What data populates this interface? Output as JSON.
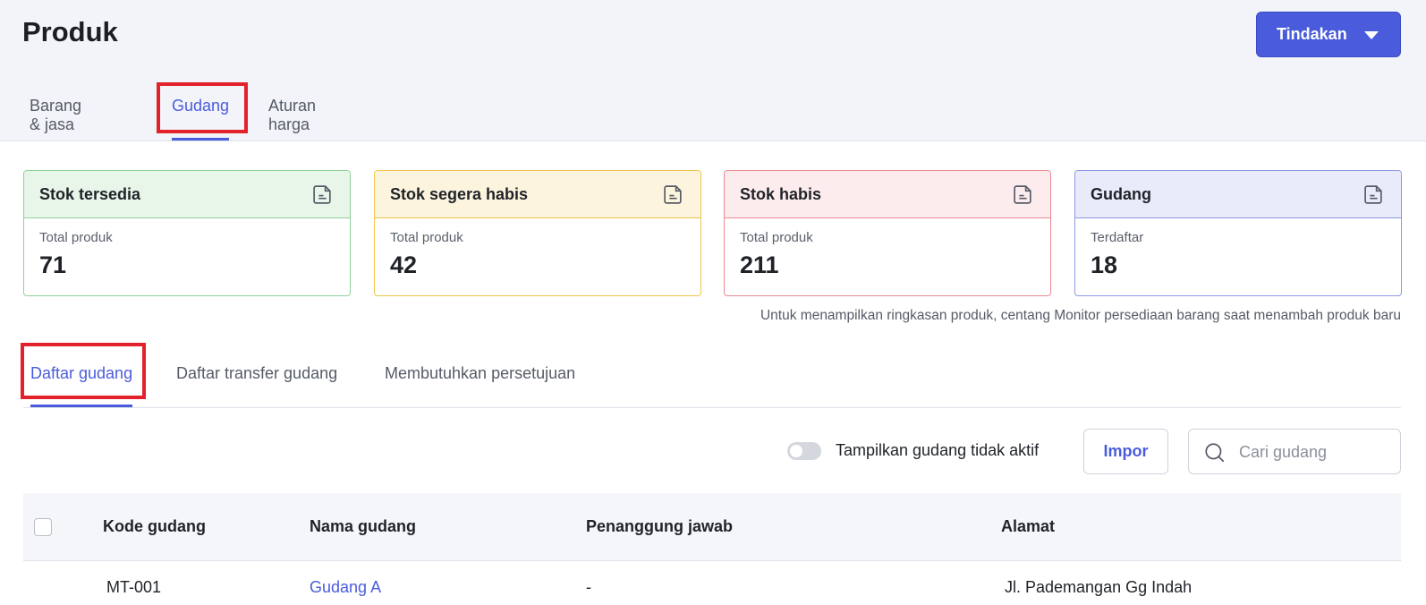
{
  "header": {
    "title": "Produk",
    "action_label": "Tindakan"
  },
  "top_tabs": [
    {
      "label": "Barang & jasa",
      "active": false
    },
    {
      "label": "Gudang",
      "active": true
    },
    {
      "label": "Aturan harga",
      "active": false
    }
  ],
  "summary_cards": [
    {
      "title": "Stok tersedia",
      "sub": "Total produk",
      "value": "71",
      "bg": "#e8f5e9",
      "border": "#8fd19a"
    },
    {
      "title": "Stok segera habis",
      "sub": "Total produk",
      "value": "42",
      "bg": "#fdf4de",
      "border": "#f0c64a"
    },
    {
      "title": "Stok habis",
      "sub": "Total produk",
      "value": "211",
      "bg": "#fdecee",
      "border": "#e98a92"
    },
    {
      "title": "Gudang",
      "sub": "Terdaftar",
      "value": "18",
      "bg": "#e9ebfb",
      "border": "#8d98e6"
    }
  ],
  "summary_note": "Untuk menampilkan ringkasan produk, centang Monitor persediaan barang saat menambah produk baru",
  "sub_tabs": [
    {
      "label": "Daftar gudang",
      "active": true
    },
    {
      "label": "Daftar transfer gudang",
      "active": false
    },
    {
      "label": "Membutuhkan persetujuan",
      "active": false
    }
  ],
  "toolbar": {
    "toggle_label": "Tampilkan gudang tidak aktif",
    "toggle_on": false,
    "import_label": "Impor",
    "search_placeholder": "Cari gudang",
    "search_value": ""
  },
  "table": {
    "columns": [
      "Kode gudang",
      "Nama gudang",
      "Penanggung jawab",
      "Alamat"
    ],
    "rows": [
      [
        "MT-001",
        "Gudang A",
        "-",
        "Jl. Pademangan Gg Indah"
      ]
    ]
  },
  "colors": {
    "accent": "#4a5cdc",
    "highlight": "#e3212b"
  }
}
